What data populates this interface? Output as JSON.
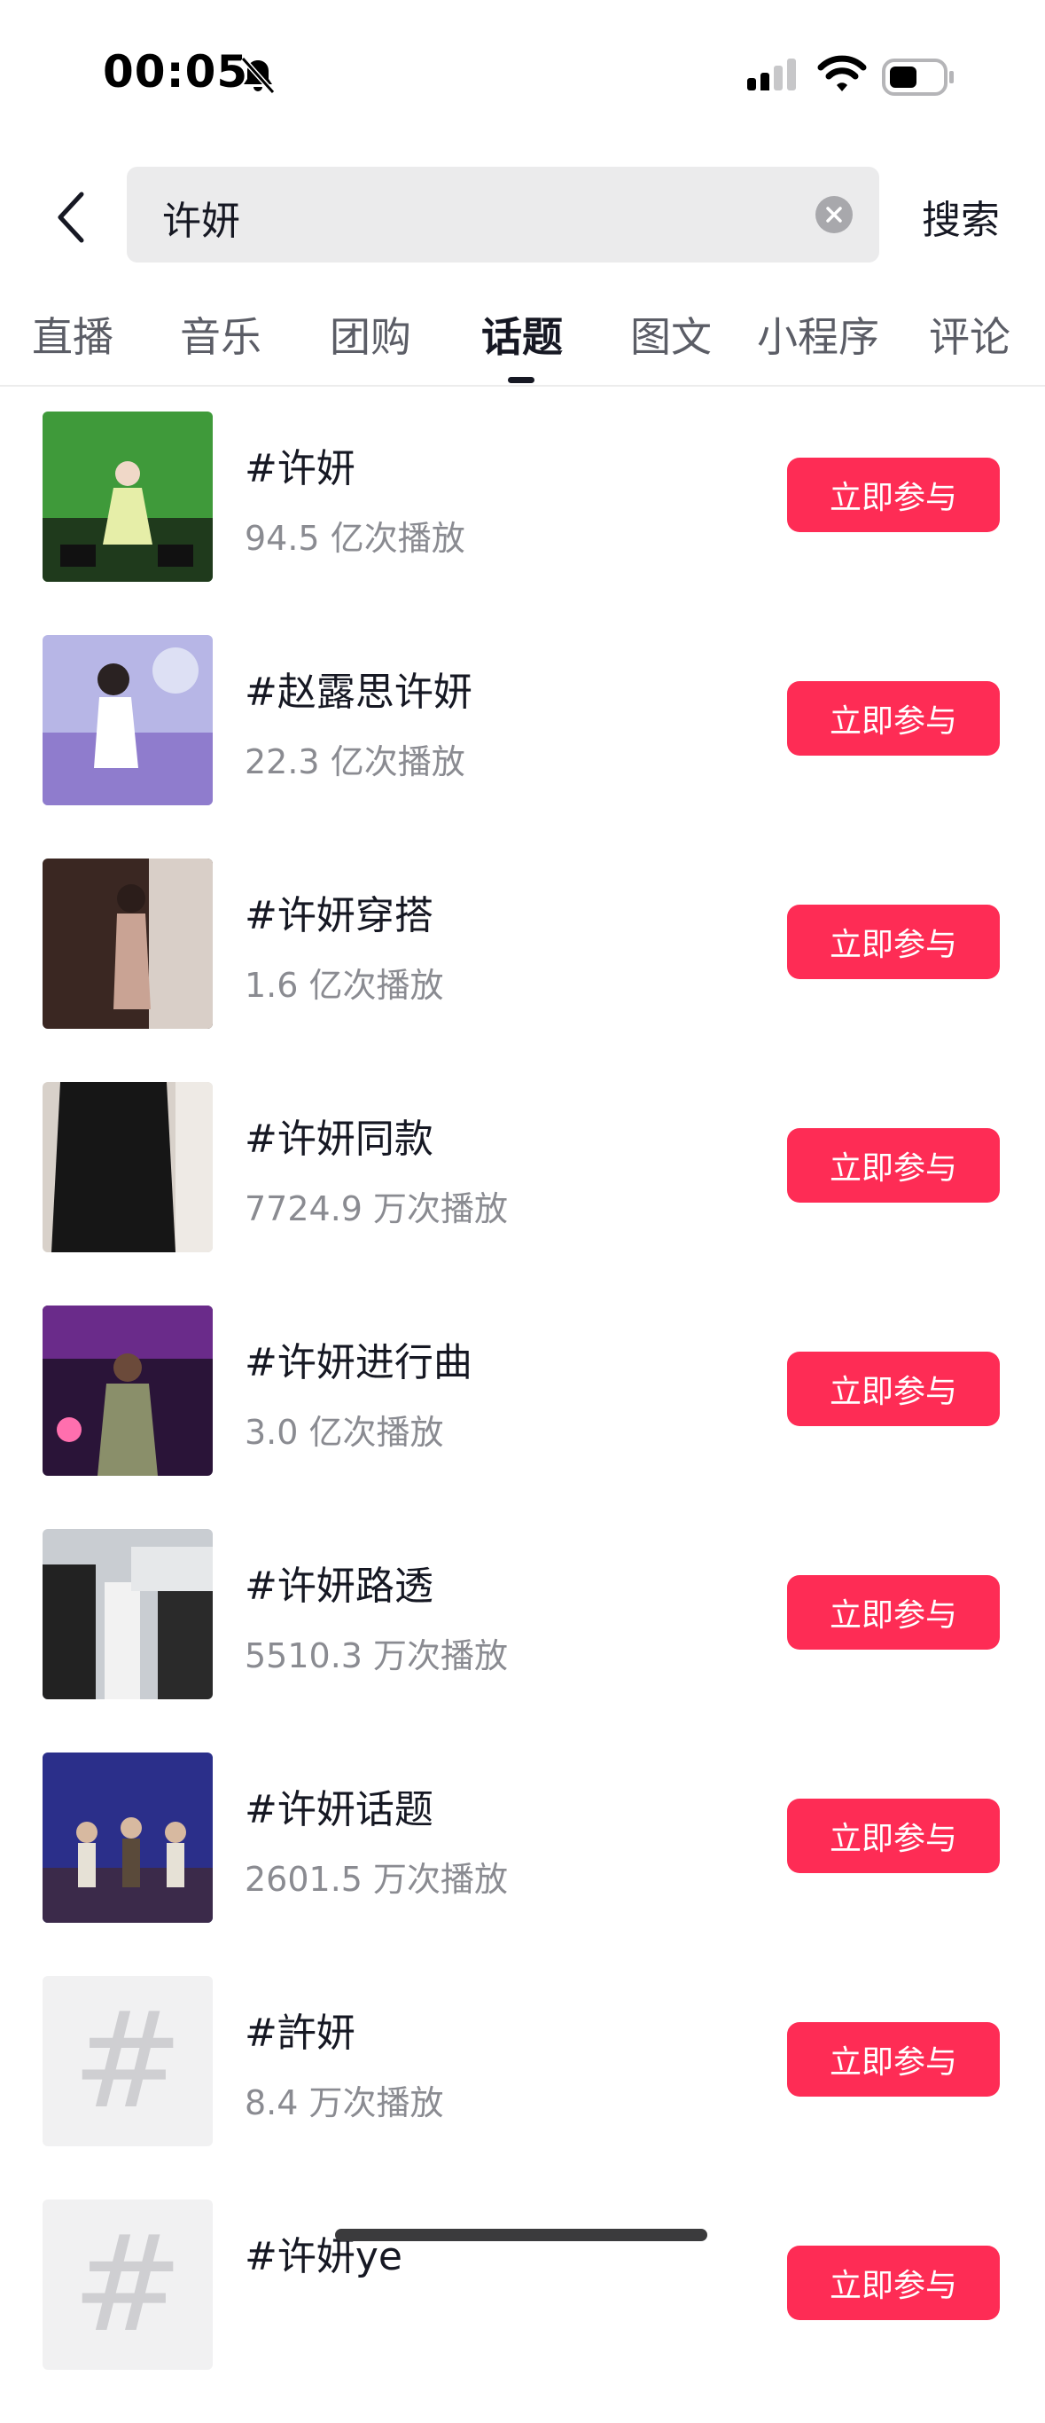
{
  "status_bar": {
    "time": "00:05"
  },
  "search": {
    "query": "许妍",
    "submit_label": "搜索"
  },
  "tabs": [
    {
      "label": "直播",
      "active": false
    },
    {
      "label": "音乐",
      "active": false
    },
    {
      "label": "团购",
      "active": false
    },
    {
      "label": "话题",
      "active": true
    },
    {
      "label": "图文",
      "active": false
    },
    {
      "label": "小程序",
      "active": false
    },
    {
      "label": "评论",
      "active": false
    }
  ],
  "topics": [
    {
      "title": "#许妍",
      "plays": "94.5 亿次播放",
      "action": "立即参与"
    },
    {
      "title": "#赵露思许妍",
      "plays": "22.3 亿次播放",
      "action": "立即参与"
    },
    {
      "title": "#许妍穿搭",
      "plays": "1.6 亿次播放",
      "action": "立即参与"
    },
    {
      "title": "#许妍同款",
      "plays": "7724.9 万次播放",
      "action": "立即参与"
    },
    {
      "title": "#许妍进行曲",
      "plays": "3.0 亿次播放",
      "action": "立即参与"
    },
    {
      "title": "#许妍路透",
      "plays": "5510.3 万次播放",
      "action": "立即参与"
    },
    {
      "title": "#许妍话题",
      "plays": "2601.5 万次播放",
      "action": "立即参与"
    },
    {
      "title": "#許妍",
      "plays": "8.4 万次播放",
      "action": "立即参与"
    },
    {
      "title": "#许妍ye",
      "plays": "",
      "action": "立即参与"
    }
  ],
  "placeholder_thumb": {
    "symbol": "#"
  },
  "colors": {
    "accent": "#fe2c55",
    "text": "#161823",
    "secondary": "#8a8b91"
  }
}
